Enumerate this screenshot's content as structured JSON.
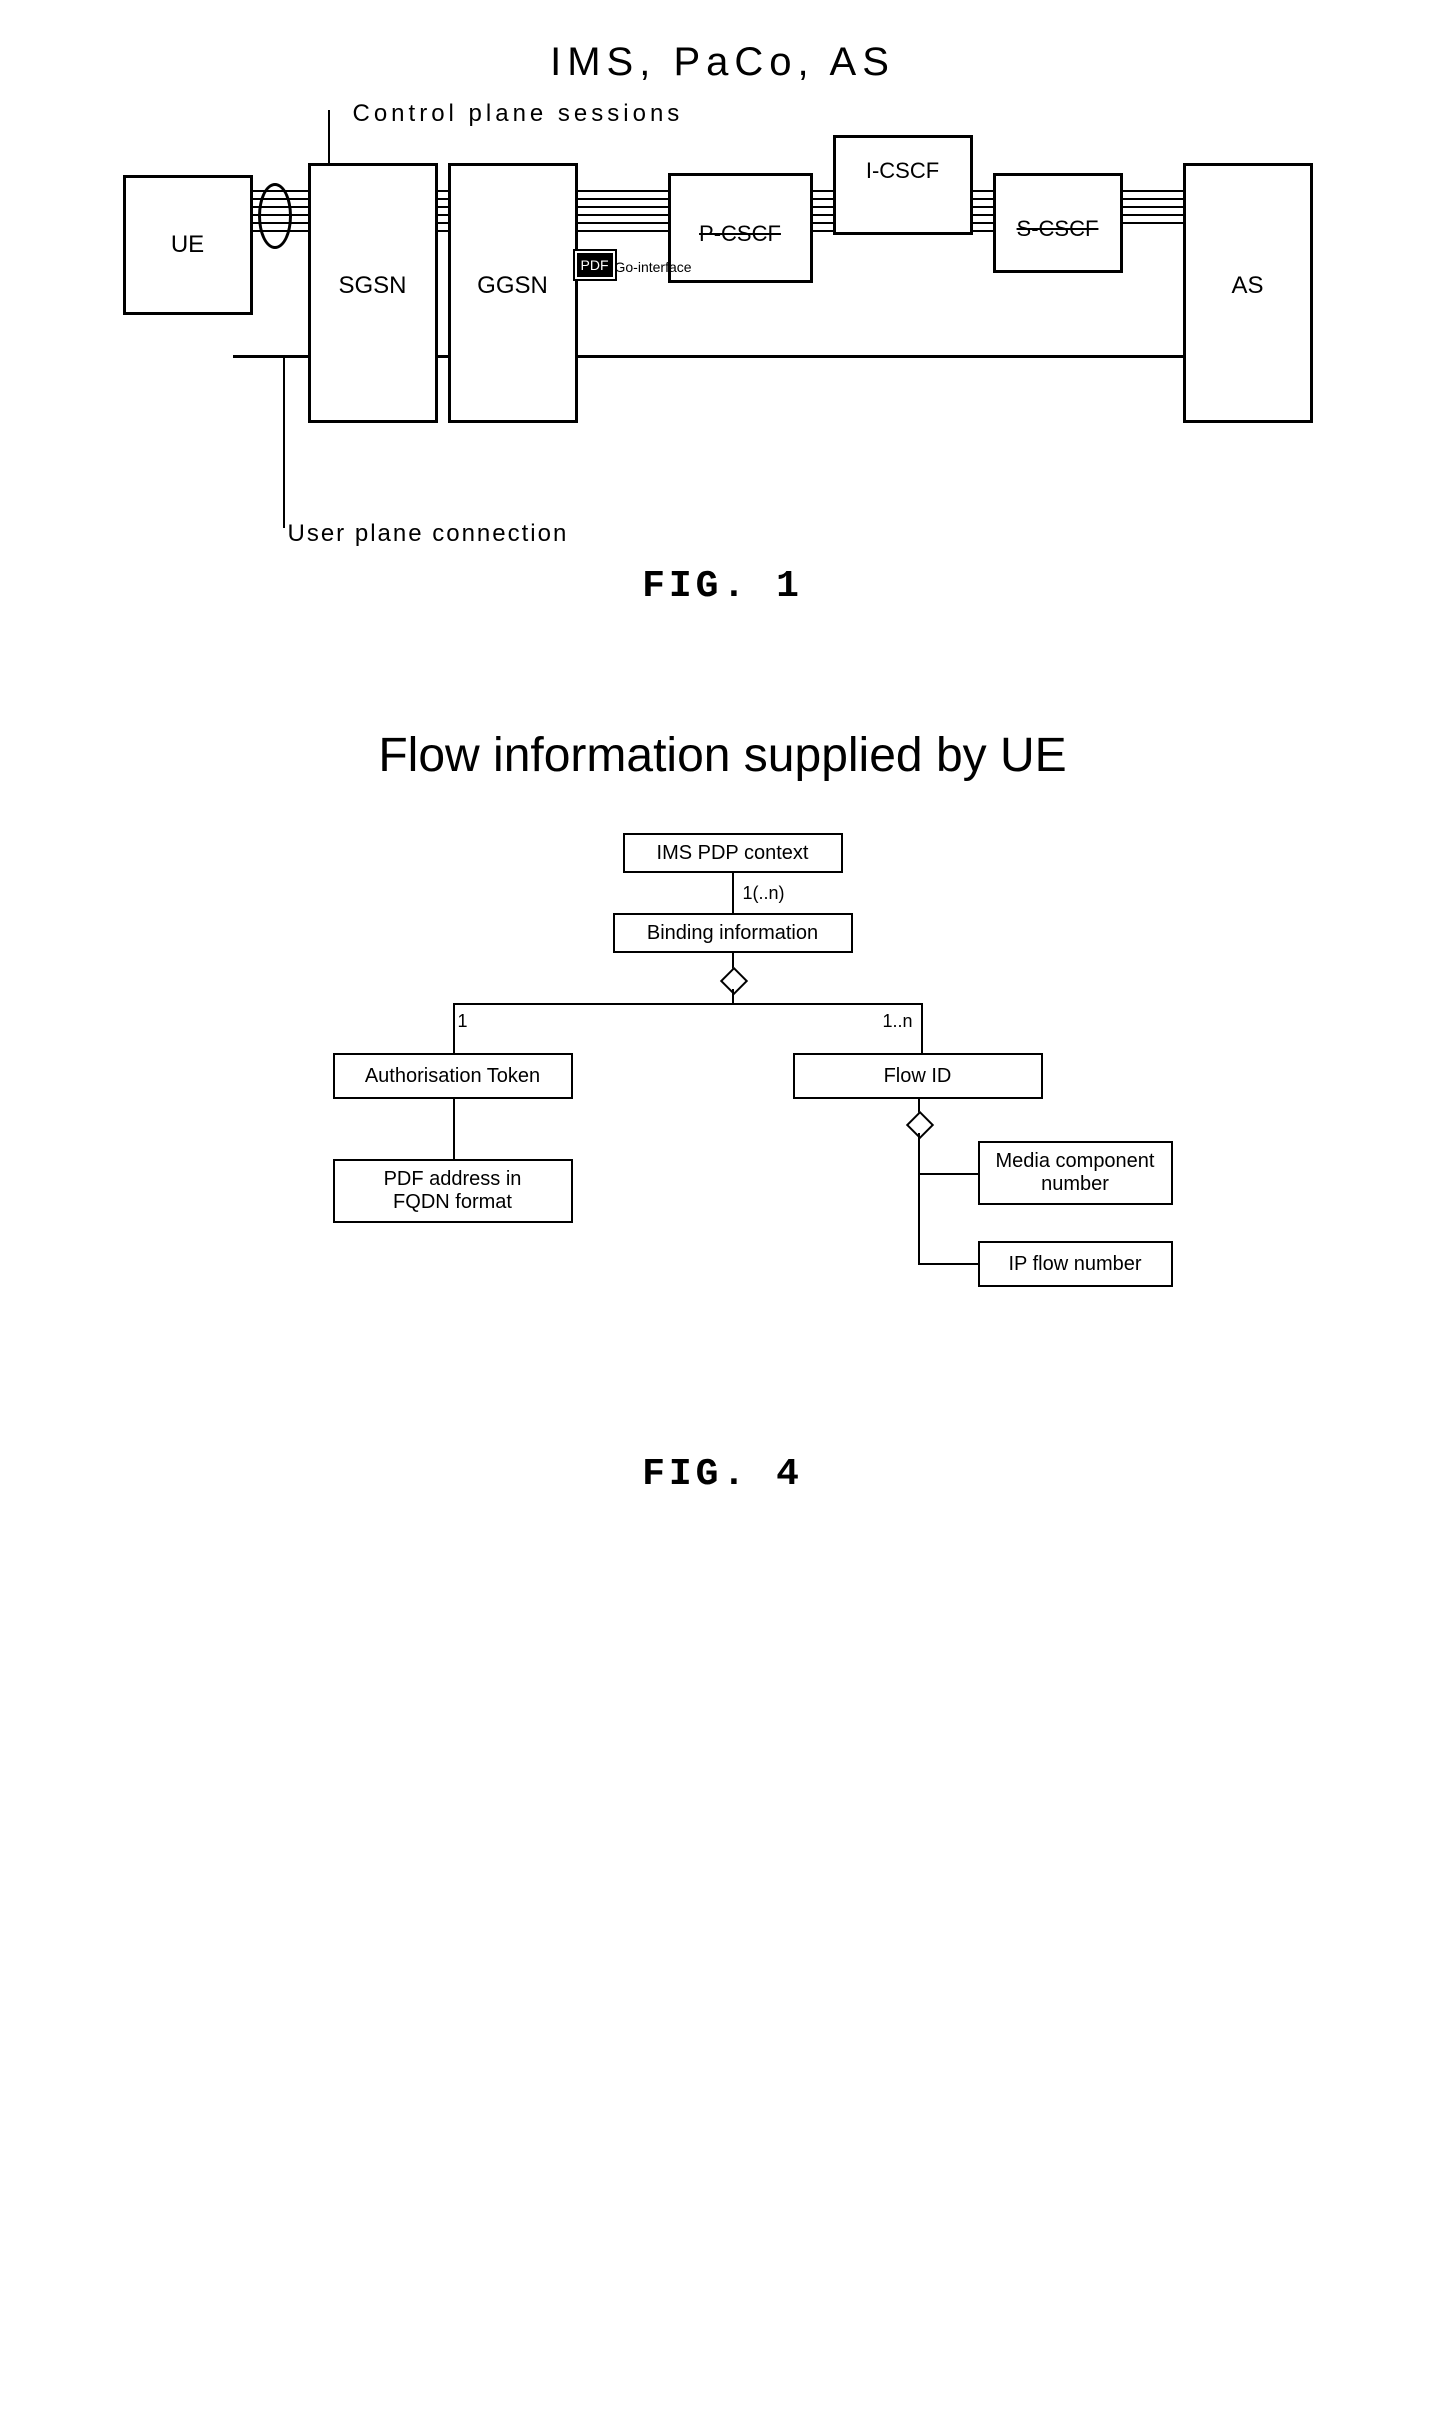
{
  "fig1": {
    "title": "IMS, PaCo, AS",
    "control_plane_label": "Control plane sessions",
    "user_plane_label": "User plane connection",
    "pdf_label": "PDF",
    "go_label": "Go-interface",
    "boxes": {
      "ue": "UE",
      "sgsn": "SGSN",
      "ggsn": "GGSN",
      "pcscf": "P-CSCF",
      "icscf": "I-CSCF",
      "scscf": "S-CSCF",
      "as": "AS"
    },
    "caption": "FIG. 1"
  },
  "fig4": {
    "title": "Flow information supplied by UE",
    "nodes": {
      "ims_pdp": "IMS PDP context",
      "binding": "Binding information",
      "auth_token": "Authorisation Token",
      "flow_id": "Flow ID",
      "pdf_addr": "PDF address in\nFQDN format",
      "media_comp": "Media component\nnumber",
      "ip_flow": "IP flow number"
    },
    "mults": {
      "binding": "1(..n)",
      "auth": "1",
      "flow": "1..n"
    },
    "caption": "FIG. 4"
  }
}
